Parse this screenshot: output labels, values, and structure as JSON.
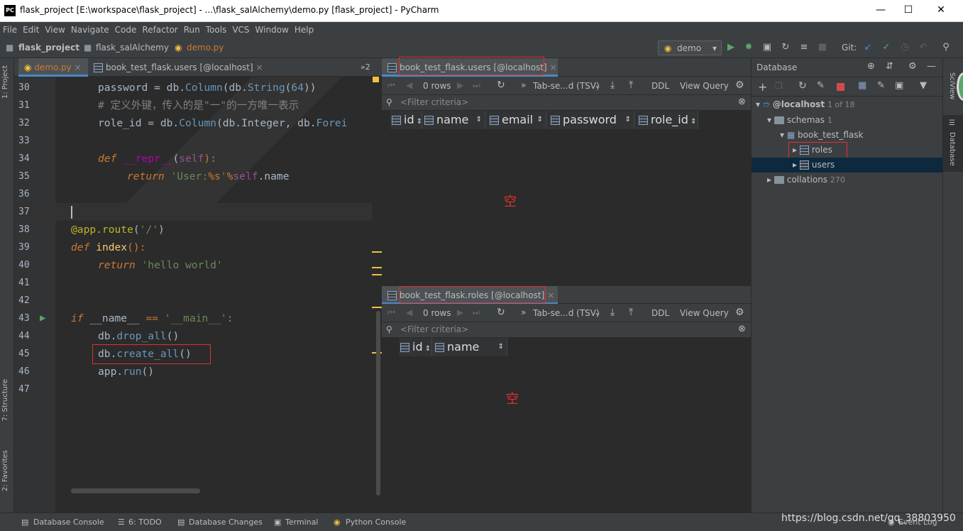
{
  "window": {
    "title": "flask_project [E:\\workspace\\flask_project] - ...\\flask_salAlchemy\\demo.py [flask_project] - PyCharm",
    "logo": "PC"
  },
  "menu": [
    "File",
    "Edit",
    "View",
    "Navigate",
    "Code",
    "Refactor",
    "Run",
    "Tools",
    "VCS",
    "Window",
    "Help"
  ],
  "breadcrumb": {
    "project": "flask_project",
    "folder": "flask_salAlchemy",
    "file": "demo.py"
  },
  "run_config": "demo",
  "git_label": "Git:",
  "left_tools": {
    "project": "1: Project",
    "structure": "7: Structure",
    "favorites": "2: Favorites"
  },
  "editor_tabs": [
    {
      "label": "demo.py"
    },
    {
      "label": "book_test_flask.users [@localhost]"
    }
  ],
  "tabs_more": "»2",
  "code_lines": [
    {
      "n": "30"
    },
    {
      "n": "31"
    },
    {
      "n": "32"
    },
    {
      "n": "33"
    },
    {
      "n": "34"
    },
    {
      "n": "35"
    },
    {
      "n": "36"
    },
    {
      "n": "37"
    },
    {
      "n": "38"
    },
    {
      "n": "39"
    },
    {
      "n": "40"
    },
    {
      "n": "41"
    },
    {
      "n": "42"
    },
    {
      "n": "43"
    },
    {
      "n": "44"
    },
    {
      "n": "45"
    },
    {
      "n": "46"
    },
    {
      "n": "47"
    }
  ],
  "code_text": {
    "l30a": "password",
    "l30b": " = db.",
    "l30c": "Column",
    "l30d": "(db.",
    "l30e": "String",
    "l30f": "(",
    "l30g": "64",
    "l30h": "))",
    "l31": "# 定义外键，传入的是\"一\"的一方唯一表示",
    "l32a": "role_id = db.",
    "l32b": "Column",
    "l32c": "(db.Integer, db.",
    "l32d": "Forei",
    "l34a": "def ",
    "l34b": "__repr__",
    "l34c": "(",
    "l34d": "self",
    "l34e": "):",
    "l35a": "return ",
    "l35b": "'User:",
    "l35c": "%s",
    "l35d": "'",
    "l35e": "%",
    "l35f": "self",
    "l35g": ".name",
    "l38a": "@app.route",
    "l38b": "(",
    "l38c": "'/'",
    "l38d": ")",
    "l39a": "def ",
    "l39b": "index",
    "l39c": "():",
    "l40a": "return ",
    "l40b": "'hello world'",
    "l43a": "if ",
    "l43b": "__name__ ",
    "l43c": "== ",
    "l43d": "'__main__'",
    "l43e": ":",
    "l44a": "db.",
    "l44b": "drop_all",
    "l44c": "()",
    "l45a": "db.",
    "l45b": "create_all",
    "l45c": "()",
    "l46a": "app.",
    "l46b": "run",
    "l46c": "()"
  },
  "users_pane": {
    "tab": "book_test_flask.users [@localhost]",
    "rows": "0 rows",
    "export": "Tab-se...d (TSV)",
    "ddl": "DDL",
    "view_query": "View Query",
    "filter": "<Filter criteria>",
    "columns": [
      "id",
      "name",
      "email",
      "password",
      "role_id"
    ],
    "empty": "空"
  },
  "roles_pane": {
    "tab": "book_test_flask.roles [@localhost]",
    "rows": "0 rows",
    "export": "Tab-se...d (TSV)",
    "ddl": "DDL",
    "view_query": "View Query",
    "filter": "<Filter criteria>",
    "columns": [
      "id",
      "name"
    ],
    "empty": "空"
  },
  "database": {
    "title": "Database",
    "host": "@localhost",
    "host_count": "1 of 18",
    "schemas": "schemas",
    "schemas_count": "1",
    "schema": "book_test_flask",
    "tables": [
      "roles",
      "users"
    ],
    "collations": "collations",
    "collations_count": "270"
  },
  "right_tools": {
    "sciview": "SciView",
    "database": "Database"
  },
  "status": {
    "db_console": "Database Console",
    "todo": "6: TODO",
    "db_changes": "Database Changes",
    "terminal": "Terminal",
    "python_console": "Python Console",
    "event_log": "Event Log",
    "watermark": "https://blog.csdn.net/qq_38803950"
  },
  "colors": {
    "accent": "#4a88c7",
    "highlight_red": "#e03030",
    "run_green": "#59a869",
    "selection": "#0d293e"
  }
}
